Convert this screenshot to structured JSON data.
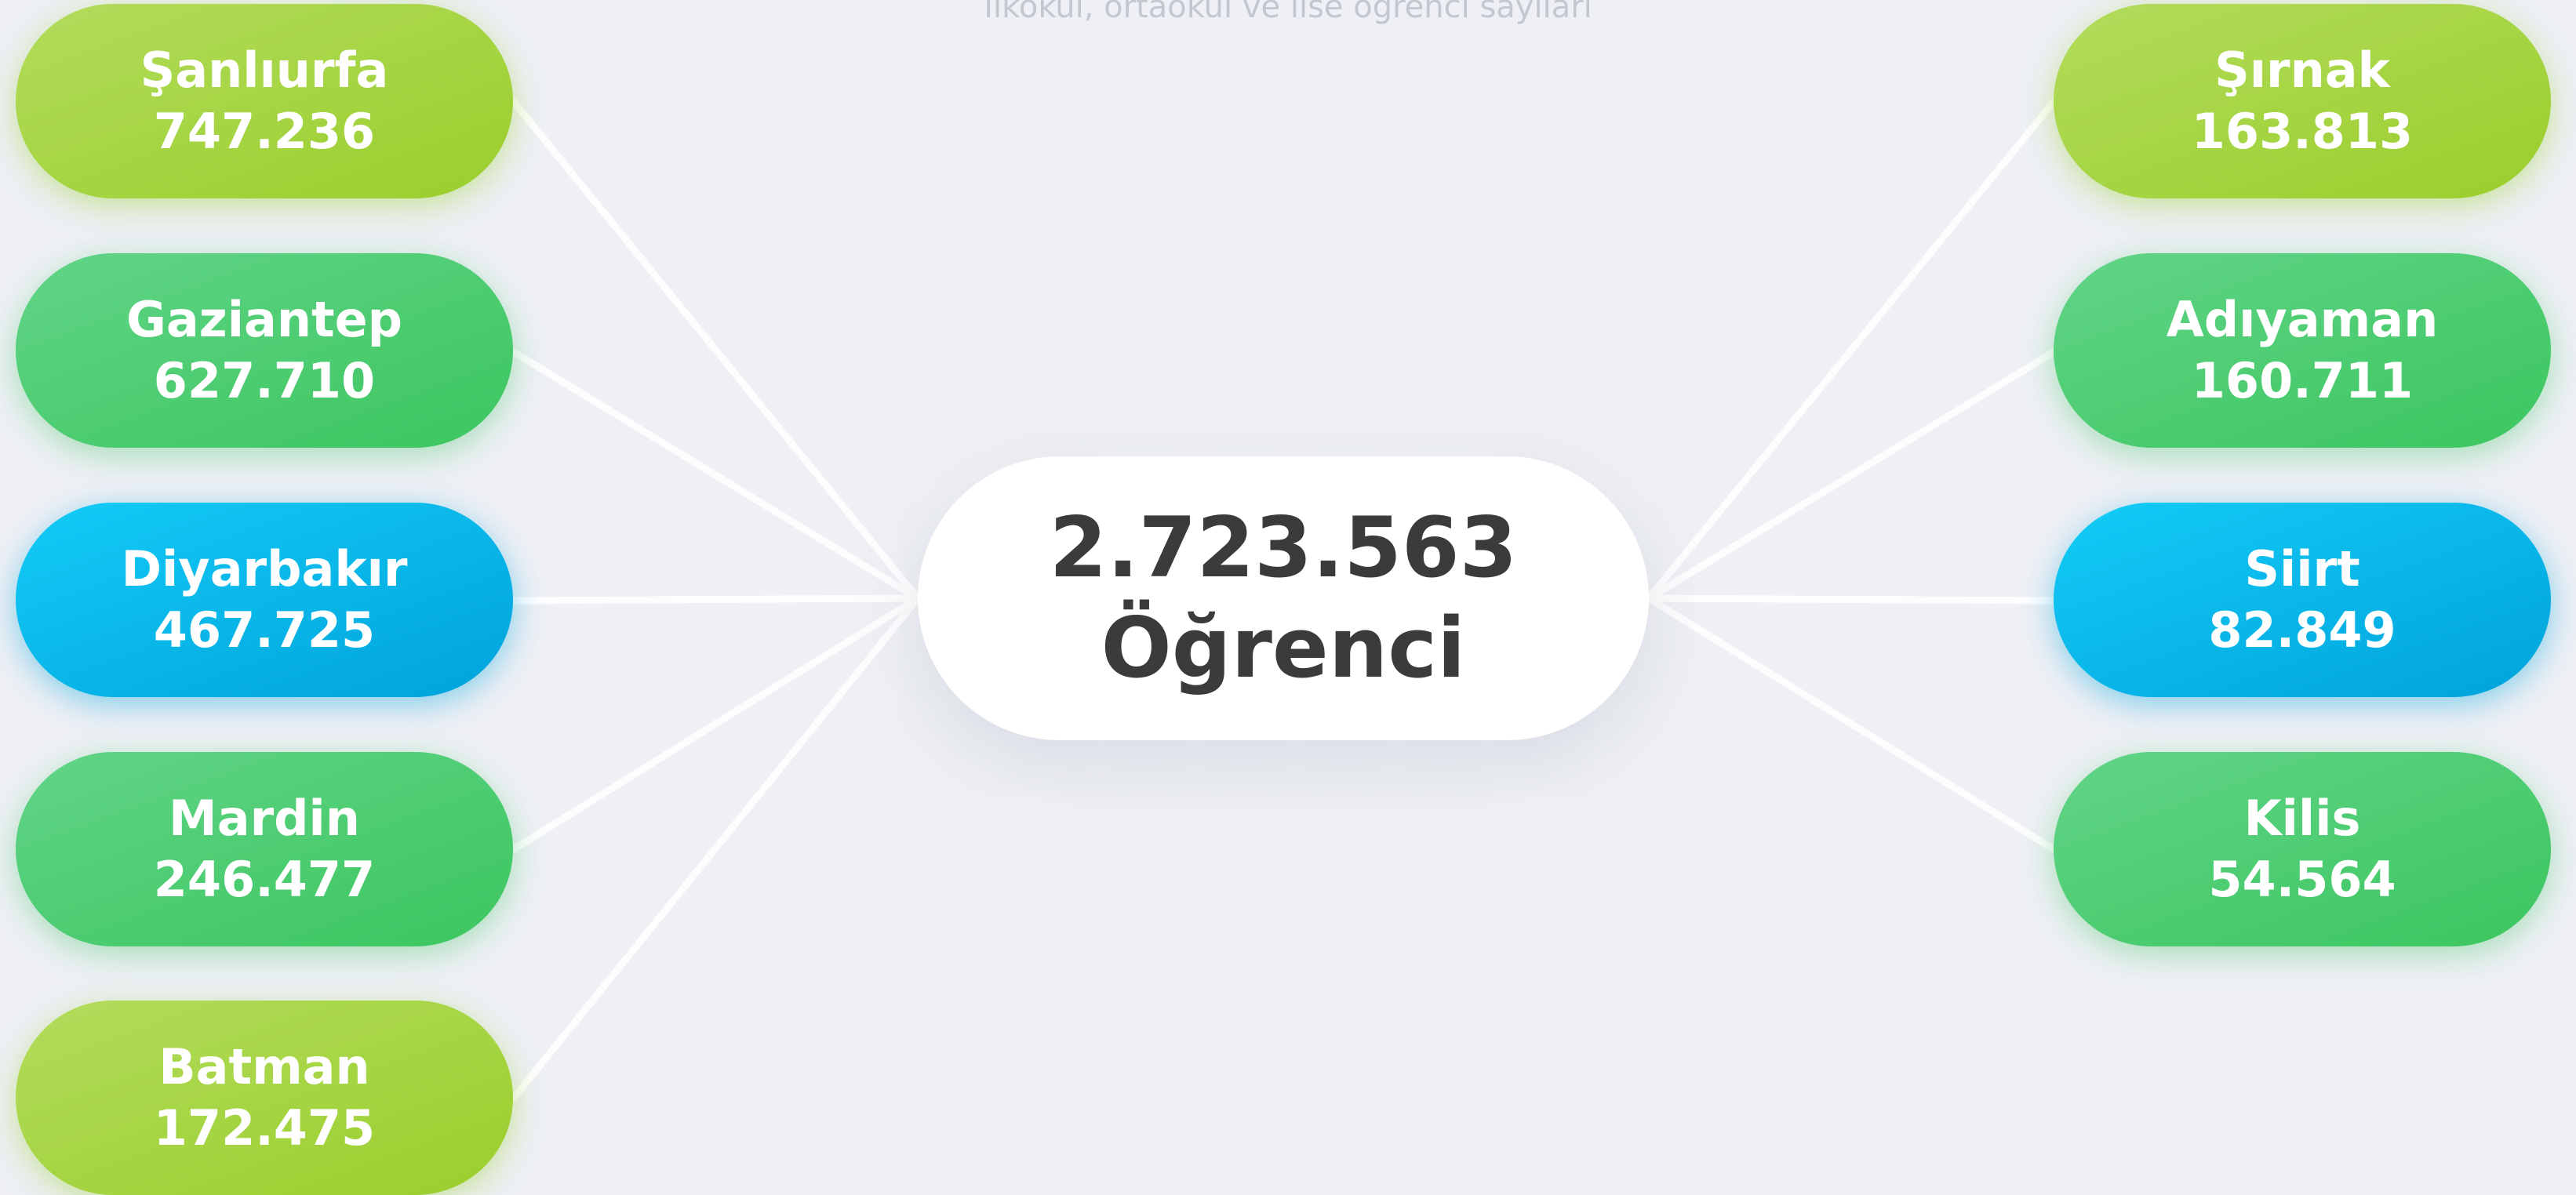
{
  "subtitle": "İlkokul, ortaokul ve lise öğrenci sayıları",
  "center": {
    "total": "2.723.563",
    "label": "Öğrenci"
  },
  "left_nodes": [
    {
      "name": "Şanlıurfa",
      "value": "747.236",
      "color": "#9ace2c"
    },
    {
      "name": "Gaziantep",
      "value": "627.710",
      "color": "#3cc65f"
    },
    {
      "name": "Diyarbakır",
      "value": "467.725",
      "color": "#00a3db"
    },
    {
      "name": "Mardin",
      "value": "246.477",
      "color": "#3cc65f"
    },
    {
      "name": "Batman",
      "value": "172.475",
      "color": "#9ace2c"
    }
  ],
  "right_nodes": [
    {
      "name": "Şırnak",
      "value": "163.813",
      "color": "#9ace2c"
    },
    {
      "name": "Adıyaman",
      "value": "160.711",
      "color": "#3cc65f"
    },
    {
      "name": "Siirt",
      "value": "82.849",
      "color": "#00a3db"
    },
    {
      "name": "Kilis",
      "value": "54.564",
      "color": "#3cc65f"
    }
  ]
}
